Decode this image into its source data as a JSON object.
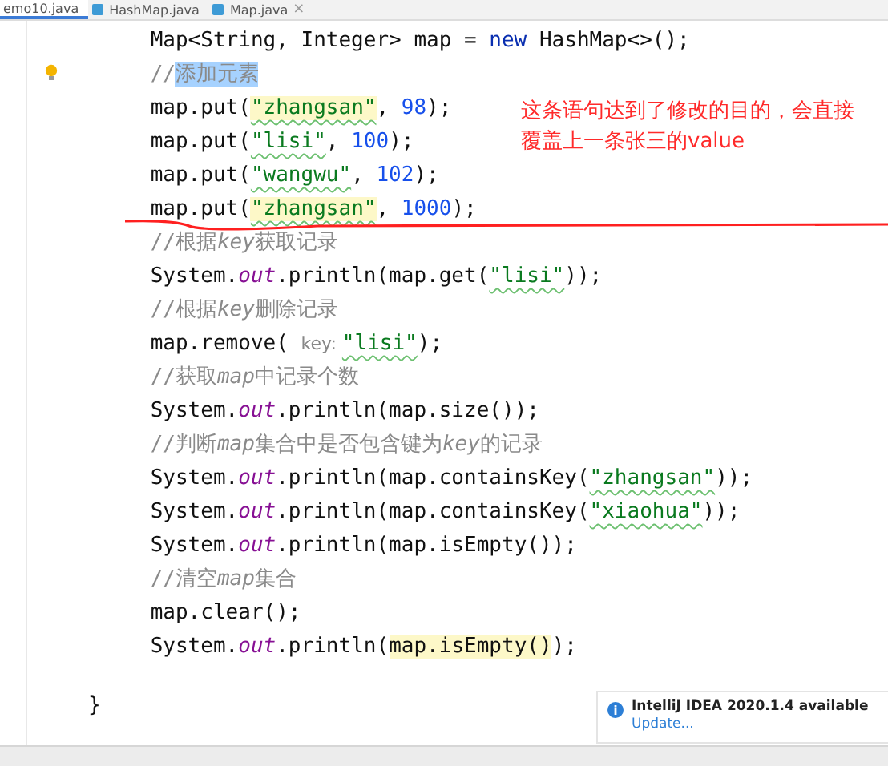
{
  "tabs": [
    {
      "label": "emo10.java",
      "selected": true,
      "closable": false
    },
    {
      "label": "HashMap.java",
      "selected": false,
      "closable": false
    },
    {
      "label": "Map.java",
      "selected": false,
      "closable": true,
      "close": "×"
    }
  ],
  "lines": [
    {
      "segments": [
        {
          "text": "Map<String, Integer> map = ",
          "kind": "plain"
        },
        {
          "text": "new",
          "kind": "keyword"
        },
        {
          "text": " HashMap<>();",
          "kind": "plain"
        }
      ]
    },
    {
      "bulb": true,
      "segments": [
        {
          "text": "//",
          "kind": "comment"
        },
        {
          "text": "添加元素",
          "kind": "comment",
          "selected": true
        }
      ]
    },
    {
      "segments": [
        {
          "text": "map.put(",
          "kind": "plain"
        },
        {
          "text": "\"zhangsan\"",
          "kind": "string",
          "highlighted": true,
          "typo": true
        },
        {
          "text": ", ",
          "kind": "plain"
        },
        {
          "text": "98",
          "kind": "number"
        },
        {
          "text": ");",
          "kind": "plain"
        }
      ]
    },
    {
      "segments": [
        {
          "text": "map.put(",
          "kind": "plain"
        },
        {
          "text": "\"lisi\"",
          "kind": "string",
          "typo": true
        },
        {
          "text": ", ",
          "kind": "plain"
        },
        {
          "text": "100",
          "kind": "number"
        },
        {
          "text": ");",
          "kind": "plain"
        }
      ]
    },
    {
      "segments": [
        {
          "text": "map.put(",
          "kind": "plain"
        },
        {
          "text": "\"wangwu\"",
          "kind": "string",
          "typo": true
        },
        {
          "text": ", ",
          "kind": "plain"
        },
        {
          "text": "102",
          "kind": "number"
        },
        {
          "text": ");",
          "kind": "plain"
        }
      ]
    },
    {
      "underlined": true,
      "segments": [
        {
          "text": "map.put(",
          "kind": "plain"
        },
        {
          "text": "\"zhangsan\"",
          "kind": "string",
          "highlighted": true,
          "typo": true
        },
        {
          "text": ", ",
          "kind": "plain"
        },
        {
          "text": "1000",
          "kind": "number"
        },
        {
          "text": ");",
          "kind": "plain"
        }
      ]
    },
    {
      "segments": [
        {
          "text": "//根据",
          "kind": "comment"
        },
        {
          "text": "key",
          "kind": "comment-italic"
        },
        {
          "text": "获取记录",
          "kind": "comment"
        }
      ]
    },
    {
      "segments": [
        {
          "text": "System.",
          "kind": "plain"
        },
        {
          "text": "out",
          "kind": "field"
        },
        {
          "text": ".println(map.get(",
          "kind": "plain"
        },
        {
          "text": "\"lisi\"",
          "kind": "string",
          "typo": true
        },
        {
          "text": "));",
          "kind": "plain"
        }
      ]
    },
    {
      "segments": [
        {
          "text": "//根据",
          "kind": "comment"
        },
        {
          "text": "key",
          "kind": "comment-italic"
        },
        {
          "text": "删除记录",
          "kind": "comment"
        }
      ]
    },
    {
      "segments": [
        {
          "text": "map.remove( ",
          "kind": "plain"
        },
        {
          "text": "key: ",
          "kind": "hint"
        },
        {
          "text": "\"lisi\"",
          "kind": "string",
          "typo": true
        },
        {
          "text": ");",
          "kind": "plain"
        }
      ]
    },
    {
      "segments": [
        {
          "text": "//获取",
          "kind": "comment"
        },
        {
          "text": "map",
          "kind": "comment-italic"
        },
        {
          "text": "中记录个数",
          "kind": "comment"
        }
      ]
    },
    {
      "segments": [
        {
          "text": "System.",
          "kind": "plain"
        },
        {
          "text": "out",
          "kind": "field"
        },
        {
          "text": ".println(map.size());",
          "kind": "plain"
        }
      ]
    },
    {
      "segments": [
        {
          "text": "//判断",
          "kind": "comment"
        },
        {
          "text": "map",
          "kind": "comment-italic"
        },
        {
          "text": "集合中是否包含键为",
          "kind": "comment"
        },
        {
          "text": "key",
          "kind": "comment-italic"
        },
        {
          "text": "的记录",
          "kind": "comment"
        }
      ]
    },
    {
      "segments": [
        {
          "text": "System.",
          "kind": "plain"
        },
        {
          "text": "out",
          "kind": "field"
        },
        {
          "text": ".println(map.containsKey(",
          "kind": "plain"
        },
        {
          "text": "\"zhangsan\"",
          "kind": "string",
          "typo": true
        },
        {
          "text": "));",
          "kind": "plain"
        }
      ]
    },
    {
      "segments": [
        {
          "text": "System.",
          "kind": "plain"
        },
        {
          "text": "out",
          "kind": "field"
        },
        {
          "text": ".println(map.containsKey(",
          "kind": "plain"
        },
        {
          "text": "\"xiaohua\"",
          "kind": "string",
          "typo": true
        },
        {
          "text": "));",
          "kind": "plain"
        }
      ]
    },
    {
      "segments": [
        {
          "text": "System.",
          "kind": "plain"
        },
        {
          "text": "out",
          "kind": "field"
        },
        {
          "text": ".println(map.isEmpty());",
          "kind": "plain"
        }
      ]
    },
    {
      "segments": [
        {
          "text": "//清空",
          "kind": "comment"
        },
        {
          "text": "map",
          "kind": "comment-italic"
        },
        {
          "text": "集合",
          "kind": "comment"
        }
      ]
    },
    {
      "segments": [
        {
          "text": "map.clear();",
          "kind": "plain"
        }
      ]
    },
    {
      "segments": [
        {
          "text": "System.",
          "kind": "plain"
        },
        {
          "text": "out",
          "kind": "field"
        },
        {
          "text": ".println(",
          "kind": "plain"
        },
        {
          "text": "map.isEmpty()",
          "kind": "plain",
          "highlighted": true
        },
        {
          "text": ");",
          "kind": "plain"
        }
      ]
    }
  ],
  "closing_brace": "}",
  "annotation": "这条语句达到了修改的目的，会直接覆盖上一条张三的value",
  "notification": {
    "title": "IntelliJ IDEA 2020.1.4 available",
    "link": "Update..."
  }
}
